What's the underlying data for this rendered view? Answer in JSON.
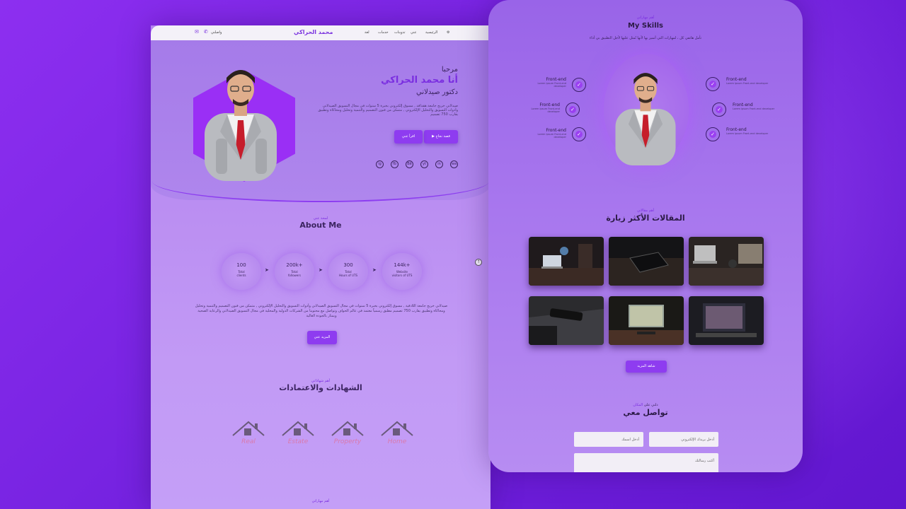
{
  "left": {
    "nav": {
      "brand": "محمد الحراكي",
      "links": [
        "الرئيسية",
        "عني",
        "تدوينات",
        "خدمات",
        "لغة"
      ],
      "contact": "واصلني"
    },
    "hero": {
      "greeting": "مرحبا",
      "name": "أنا محمد الحراكي",
      "role": "دكتور صيدلاني",
      "desc": "صيدلاني خريج جامعة هقدافد , مسوق إلكتروني بخبرة 5 سنوات في مجال التسويق الصيدلاني وأدوات التسويق والتحليل الإلكتروني , متمكن من فنون التصميم والتنمية وتحليل ومحاكاة وتطبيق يقارب 750 تصميم",
      "btn_contact": "قصة نجاح",
      "btn_read": "اقرأ عني",
      "socials": [
        "ig",
        "fb",
        "Bē",
        "yt",
        "in",
        "wa"
      ]
    },
    "about": {
      "sub": "لمحة عني",
      "title": "About Me",
      "stats": [
        {
          "value": "100",
          "label": "Total\nclients"
        },
        {
          "value": "200k+",
          "label": "Total\nfollowers"
        },
        {
          "value": "300",
          "label": "Total\nHours of UTS"
        },
        {
          "value": "144k+",
          "label": "Website\nvisitors of UTS"
        }
      ],
      "desc": "صيدلاني خريج جامعة اللاذقية , مسوق إلكتروني بخبرة 5 سنوات في مجال التسويق الصيدلاني وأدوات التسويق والتحليل الإلكتروني , متمكن من فنون التصميم والتنمية وتحليل ومحاكاة وتطبيق يقارب 750 تصميم مطبق رسمياً معتمد في عالم الحواف وتواصل مع محتوينا من الشركات الدولية والمحلية في مجال التسويق الصيدلاني والرعاية الصحية ويمتاز بالجودة العالية",
      "btn": "المزيد عني"
    },
    "certs": {
      "sub_plain": "أهم ",
      "sub_accent": "شهاداتي",
      "title": "الشهادات والاعتمادات",
      "items": [
        "Real",
        "Estate",
        "Property",
        "Home"
      ]
    },
    "footer_sub": "أهم مهاراتي"
  },
  "right": {
    "skills": {
      "sub": "أهم مهاراتي",
      "title": "My Skills",
      "desc": "تأمل هاتفي كل ، لمهارات التي أتميز بها لأنها تُمثل عليها لأجل التطبيق بي أداء",
      "left": [
        {
          "name": "Front-end",
          "sub": "Lorem ipsum Front-end developer"
        },
        {
          "name": "Front-end",
          "sub": "Lorem ipsum Front-end developer"
        },
        {
          "name": "Front-end",
          "sub": "Lorem ipsum Front-end developer"
        }
      ],
      "right": [
        {
          "name": "Front-end",
          "sub": "Lorem ipsum Front-end developer"
        },
        {
          "name": "Front-end",
          "sub": "Lorem ipsum Front-end developer"
        },
        {
          "name": "Front-end",
          "sub": "Lorem ipsum Front-end developer"
        }
      ]
    },
    "articles": {
      "sub_plain": "أهم ",
      "sub_accent": "مقالاتي",
      "title": "المقالات الأكثر زيارة",
      "more": "شاهد المزيد"
    },
    "contact": {
      "sub_plain": "دلني على ",
      "sub_accent": "المكان",
      "title": "تواصل معي",
      "name_ph": "أدخل اسمك",
      "email_ph": "أدخل بريدك الإلكتروني",
      "msg_ph": "أكتب رسالتك"
    }
  },
  "colors": {
    "accent": "#8e3cf0",
    "brand": "#7a2ee0",
    "text": "#3b2460"
  }
}
